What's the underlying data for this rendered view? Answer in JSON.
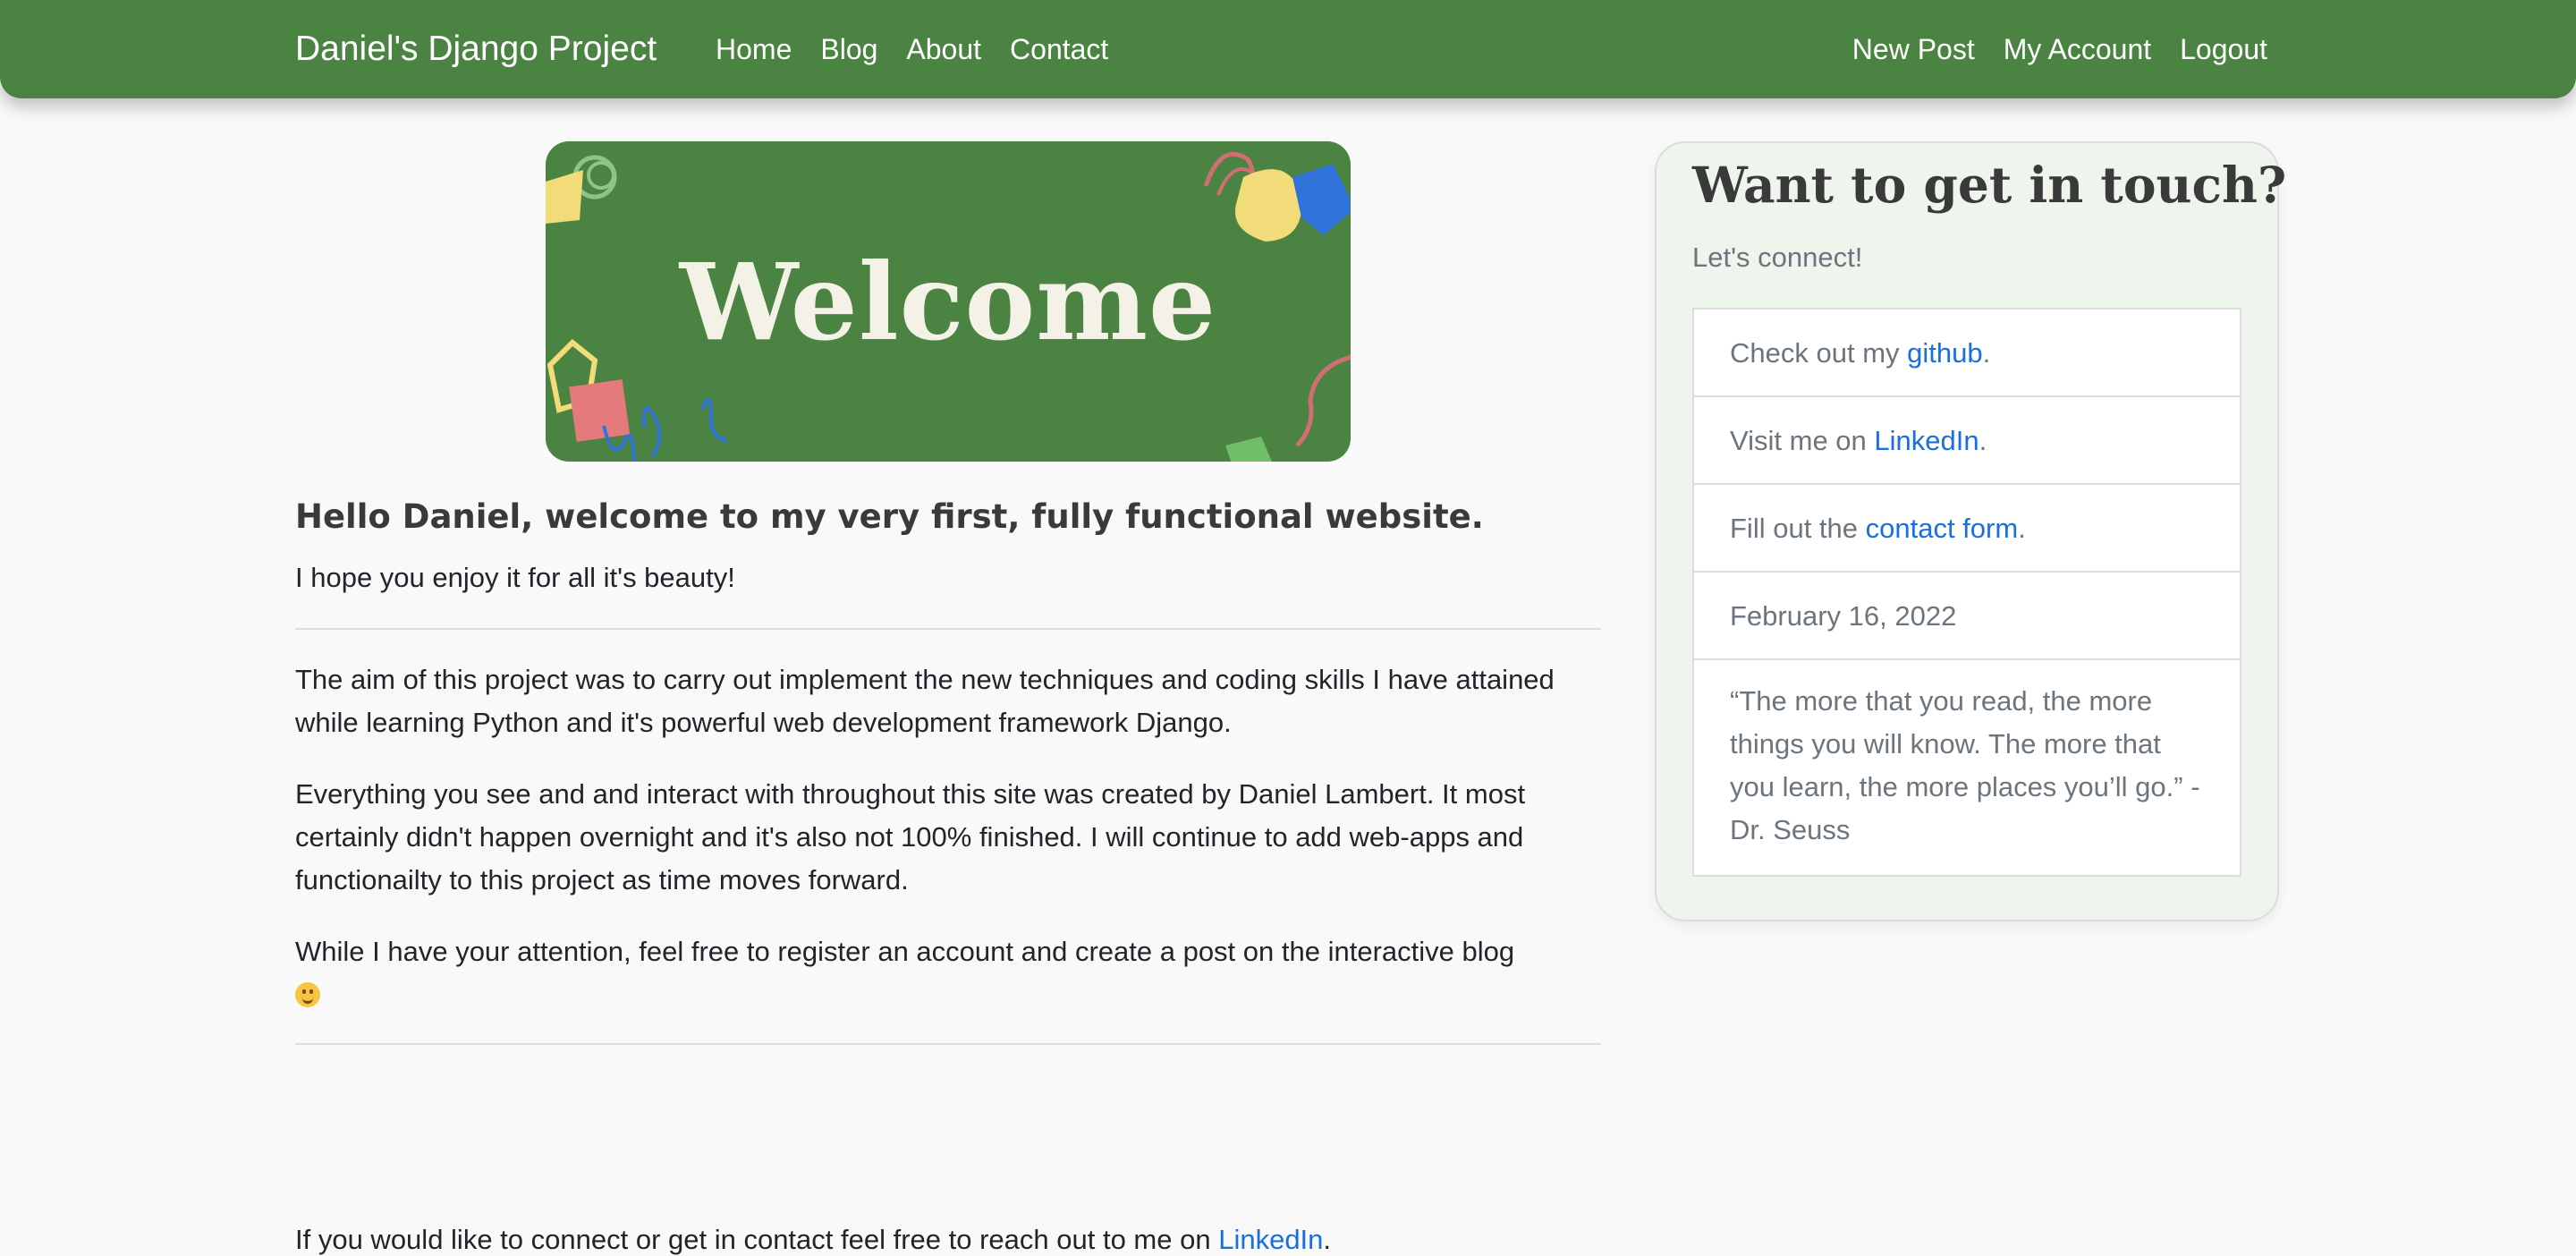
{
  "navbar": {
    "brand": "Daniel's Django Project",
    "left_links": [
      "Home",
      "Blog",
      "About",
      "Contact"
    ],
    "right_links": [
      "New Post",
      "My Account",
      "Logout"
    ],
    "color": "#4b8342"
  },
  "banner": {
    "text": "Welcome"
  },
  "content": {
    "heading": "Hello Daniel, welcome to my very first, fully functional website.",
    "subheading": "I hope you enjoy it for all it's beauty!",
    "paragraph1": "The aim of this project was to carry out implement the new techniques and coding skills I have attained while learning Python and it's powerful web development framework Django.",
    "paragraph2": "Everything you see and and interact with throughout this site was created by Daniel Lambert. It most certainly didn't happen overnight and it's also not 100% finished. I will continue to add web-apps and functionailty to this project as time moves forward.",
    "paragraph3": "While I have your attention, feel free to register an account and create a post on the interactive blog",
    "emoji": "smiling-face-emoji"
  },
  "footer": {
    "text_before": "If you would like to connect or get in contact feel free to reach out to me on ",
    "link": "LinkedIn",
    "text_after": "."
  },
  "sidebar": {
    "title": "Want to get in touch?",
    "subtitle": "Let's connect!",
    "items": [
      {
        "before": "Check out my ",
        "link": "github",
        "after": "."
      },
      {
        "before": "Visit me on ",
        "link": "LinkedIn",
        "after": "."
      },
      {
        "before": "Fill out the ",
        "link": "contact form",
        "after": "."
      }
    ],
    "date": "February 16, 2022",
    "quote": "“The more that you read, the more things you will know. The more that you learn, the more places you’ll go.” -Dr. Seuss",
    "background": "#eef5ec"
  },
  "colors": {
    "link": "#1a6fe0",
    "nav": "#4b8342"
  }
}
